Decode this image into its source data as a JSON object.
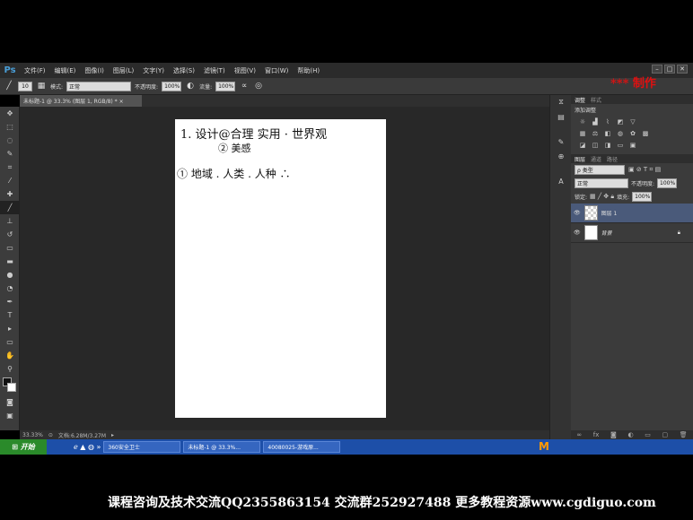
{
  "app": {
    "logo": "Ps"
  },
  "menu": [
    "文件(F)",
    "编辑(E)",
    "图像(I)",
    "图层(L)",
    "文字(Y)",
    "选择(S)",
    "滤镜(T)",
    "视图(V)",
    "窗口(W)",
    "帮助(H)"
  ],
  "window_controls": [
    "–",
    "□",
    "✕"
  ],
  "options_bar": {
    "brush_size": "10",
    "mode_label": "模式:",
    "mode_value": "正常",
    "opacity_label": "不透明度:",
    "opacity_value": "100%",
    "flow_label": "流量:",
    "flow_value": "100%"
  },
  "watermark_red": "*** 制作",
  "document_tab": "未标题-1 @ 33.3% (图层 1, RGB/8) * ×",
  "status": {
    "zoom": "33.33%",
    "doc_size": "文档:6.28M/3.27M"
  },
  "canvas_notes": {
    "line1": "1. 设计@合理 实用 · 世界观",
    "line1b": "② 美感",
    "line2": "① 地域 . 人类 . 人种 ∴"
  },
  "panels": {
    "adjust_tabs": [
      "调整",
      "样式"
    ],
    "adjust_title": "添加调整",
    "layer_tabs": [
      "图层",
      "通道",
      "路径"
    ],
    "kind_label": "ρ 类型",
    "blend_mode": "正常",
    "opacity_label": "不透明度:",
    "opacity_value": "100%",
    "lock_label": "锁定:",
    "fill_label": "填充:",
    "fill_value": "100%",
    "layers": [
      {
        "name": "图层 1"
      },
      {
        "name": "背景"
      }
    ]
  },
  "taskbar": {
    "start": "开始",
    "items": [
      "360安全卫士",
      "未标题-1 @ 33.3%...",
      "40080025-游戏原..."
    ]
  },
  "footer": {
    "text": "课程咨询及技术交流QQ2355863154  交流群252927488 更多教程资源www.cgdiguo.com"
  },
  "brand": "M"
}
